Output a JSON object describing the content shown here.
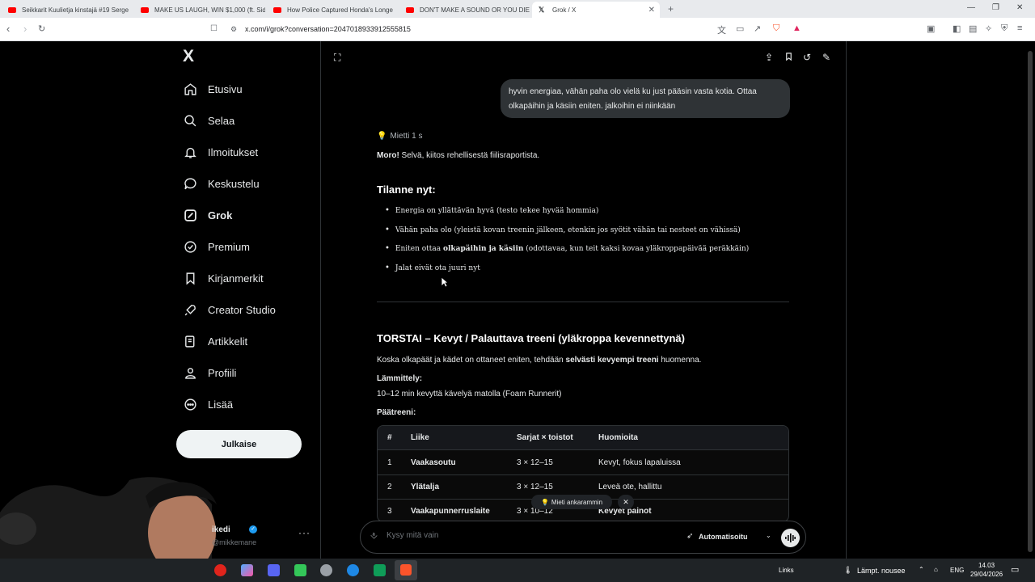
{
  "browser": {
    "tabs": [
      {
        "title": "Seikkarit Kuulietja kinstajä #19 Serge"
      },
      {
        "title": "MAKE US LAUGH, WIN $1,000 (ft. Sid"
      },
      {
        "title": "How Police Captured Honda's Longe"
      },
      {
        "title": "DON'T MAKE A SOUND OR YOU DIE"
      },
      {
        "title": "Grok / X"
      }
    ],
    "new_tab": "+",
    "url": "x.com/i/grok?conversation=2047018933912555815",
    "window_controls": [
      "—",
      "❐",
      "✕"
    ]
  },
  "sidebar": {
    "logo": "X",
    "items": [
      {
        "label": "Etusivu",
        "icon": "home-icon"
      },
      {
        "label": "Selaa",
        "icon": "search-icon"
      },
      {
        "label": "Ilmoitukset",
        "icon": "bell-icon"
      },
      {
        "label": "Keskustelu",
        "icon": "chat-icon"
      },
      {
        "label": "Grok",
        "icon": "grok-icon"
      },
      {
        "label": "Premium",
        "icon": "verified-icon"
      },
      {
        "label": "Kirjanmerkit",
        "icon": "bookmark-icon"
      },
      {
        "label": "Creator Studio",
        "icon": "rocket-icon"
      },
      {
        "label": "Artikkelit",
        "icon": "article-icon"
      },
      {
        "label": "Profiili",
        "icon": "person-icon"
      },
      {
        "label": "Lisää",
        "icon": "more-circle-icon"
      }
    ],
    "post_button": "Julkaise",
    "profile": {
      "name": "ikedi",
      "handle": "@mikkemane",
      "more": "···"
    }
  },
  "conversation": {
    "user_message": "hyvin energiaa, vähän paha olo vielä ku just pääsin vasta kotia. Ottaa olkapäihin ja käsiin eniten. jalkoihin ei niinkään",
    "thinking": "Mietti 1 s",
    "greeting_bold": "Moro!",
    "greeting_rest": " Selvä, kiitos rehellisestä fiilisraportista.",
    "section1_title": "Tilanne nyt:",
    "bullets": [
      {
        "text": "Energia on yllättävän hyvä (testo tekee hyvää hommia)",
        "bold": "",
        "rest": ""
      },
      {
        "text": "Vähän paha olo (yleistä kovan treenin jälkeen, etenkin jos syötit vähän tai nesteet on vähissä)",
        "bold": "",
        "rest": ""
      },
      {
        "text": "Eniten ottaa ",
        "bold": "olkapäihin ja käsiin",
        "rest": " (odottavaa, kun teit kaksi kovaa yläkroppapäivää peräkkäin)"
      },
      {
        "text": "Jalat eivät ota juuri nyt",
        "bold": "",
        "rest": ""
      }
    ],
    "section2_title": "TORSTAI – Kevyt / Palauttava treeni (yläkroppa kevennettynä)",
    "intro_pre": "Koska olkapäät ja kädet on ottaneet eniten, tehdään ",
    "intro_bold": "selvästi kevyempi treeni",
    "intro_post": " huomenna.",
    "warmup_label": "Lämmittely:",
    "warmup_text": "10–12 min kevyttä kävelyä matolla (Foam Runnerit)",
    "main_label": "Päätreeni:",
    "table": {
      "headers": [
        "#",
        "Liike",
        "Sarjat × toistot",
        "Huomioita"
      ],
      "rows": [
        [
          "1",
          "Vaakasoutu",
          "3 × 12–15",
          "Kevyt, fokus lapaluissa"
        ],
        [
          "2",
          "Ylätalja",
          "3 × 12–15",
          "Leveä ote, hallittu"
        ],
        [
          "3",
          "Vaakapunnerruslaite",
          "3 × 10–12",
          "Kevyet painot"
        ]
      ]
    }
  },
  "composer": {
    "think_harder": "Mieti ankarammin",
    "placeholder": "Kysy mitä vain",
    "mode": "Automatisoitu"
  },
  "taskbar": {
    "links": "Links",
    "weather": "Lämpt. nousee",
    "lang": "ENG",
    "time": "14.03",
    "date": "29/04/2026"
  }
}
